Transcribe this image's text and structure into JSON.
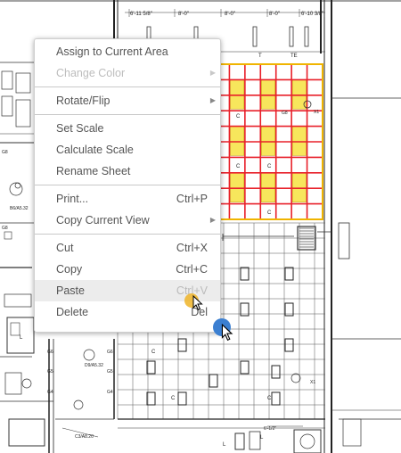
{
  "dimensions": {
    "top": [
      "6'-11 5/8\"",
      "8'-0\"",
      "8'-0\"",
      "8'-0\"",
      "6'-10 3/8\""
    ]
  },
  "plan_labels": {
    "grid_c": "C",
    "grid_g8": "G8",
    "t": "T",
    "te": "TE",
    "x1": "X1",
    "g6": "G6",
    "g5": "G5",
    "g4": "G4",
    "l": "L",
    "detail_1": "B6/A5.32",
    "detail_2": "D9/A5.32",
    "detail_3": "C3/A8.20",
    "dim_bottom": "6'-1/2\""
  },
  "context_menu": {
    "groups": [
      [
        {
          "label": "Assign to Current Area",
          "enabled": true
        },
        {
          "label": "Change Color",
          "enabled": false,
          "submenu": true
        }
      ],
      [
        {
          "label": "Rotate/Flip",
          "enabled": true,
          "submenu": true
        }
      ],
      [
        {
          "label": "Set Scale",
          "enabled": true
        },
        {
          "label": "Calculate Scale",
          "enabled": true
        },
        {
          "label": "Rename Sheet",
          "enabled": true
        }
      ],
      [
        {
          "label": "Print...",
          "enabled": true,
          "shortcut": "Ctrl+P"
        },
        {
          "label": "Copy Current View",
          "enabled": true,
          "submenu": true
        }
      ],
      [
        {
          "label": "Cut",
          "enabled": true,
          "shortcut": "Ctrl+X"
        },
        {
          "label": "Copy",
          "enabled": true,
          "shortcut": "Ctrl+C"
        },
        {
          "label": "Paste",
          "enabled": true,
          "shortcut": "Ctrl+V",
          "hovered": true
        },
        {
          "label": "Delete",
          "enabled": true,
          "shortcut": "Del"
        }
      ]
    ]
  },
  "icons": {
    "submenu": "chevron-right-icon",
    "cursor": "mouse-pointer-icon"
  },
  "colors": {
    "highlight_grid": "#e8202a",
    "highlight_fill": "#f7e65c",
    "highlight_border": "#f0b400",
    "drag_dot": "#3b7fd1",
    "touch_dot": "#eeb428"
  }
}
